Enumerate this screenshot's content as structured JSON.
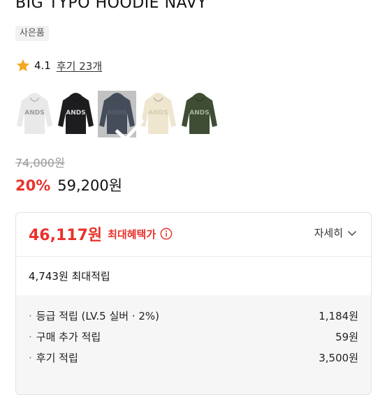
{
  "product": {
    "title": "BIG TYPO HOODIE NAVY",
    "badge": "사은품",
    "rating": "4.1",
    "review_link": "후기 23개"
  },
  "swatches": [
    {
      "name": "white",
      "color": "#e9e9ea",
      "text_color": "#9a9a9a",
      "selected": false
    },
    {
      "name": "black",
      "color": "#1d1d1f",
      "text_color": "#d9d9d9",
      "selected": false
    },
    {
      "name": "navy",
      "color": "#1d2a44",
      "text_color": "#3b4a66",
      "selected": true
    },
    {
      "name": "cream",
      "color": "#efe6cf",
      "text_color": "#d8ccb0",
      "selected": false
    },
    {
      "name": "khaki",
      "color": "#3e4d33",
      "text_color": "#aab39b",
      "selected": false
    }
  ],
  "price": {
    "original": "74,000원",
    "discount": "20%",
    "sale": "59,200원"
  },
  "benefit": {
    "max_price": "46,117원",
    "max_label": "최대혜택가",
    "detail_label": "자세히",
    "point_total": "4,743원 최대적립",
    "points": [
      {
        "label": "등급 적립 (LV.5 실버 · 2%)",
        "value": "1,184원"
      },
      {
        "label": "구매 추가 적립",
        "value": "59원"
      },
      {
        "label": "후기 적립",
        "value": "3,500원"
      }
    ]
  },
  "colors": {
    "accent": "#e8322b",
    "star": "#f5a623"
  }
}
